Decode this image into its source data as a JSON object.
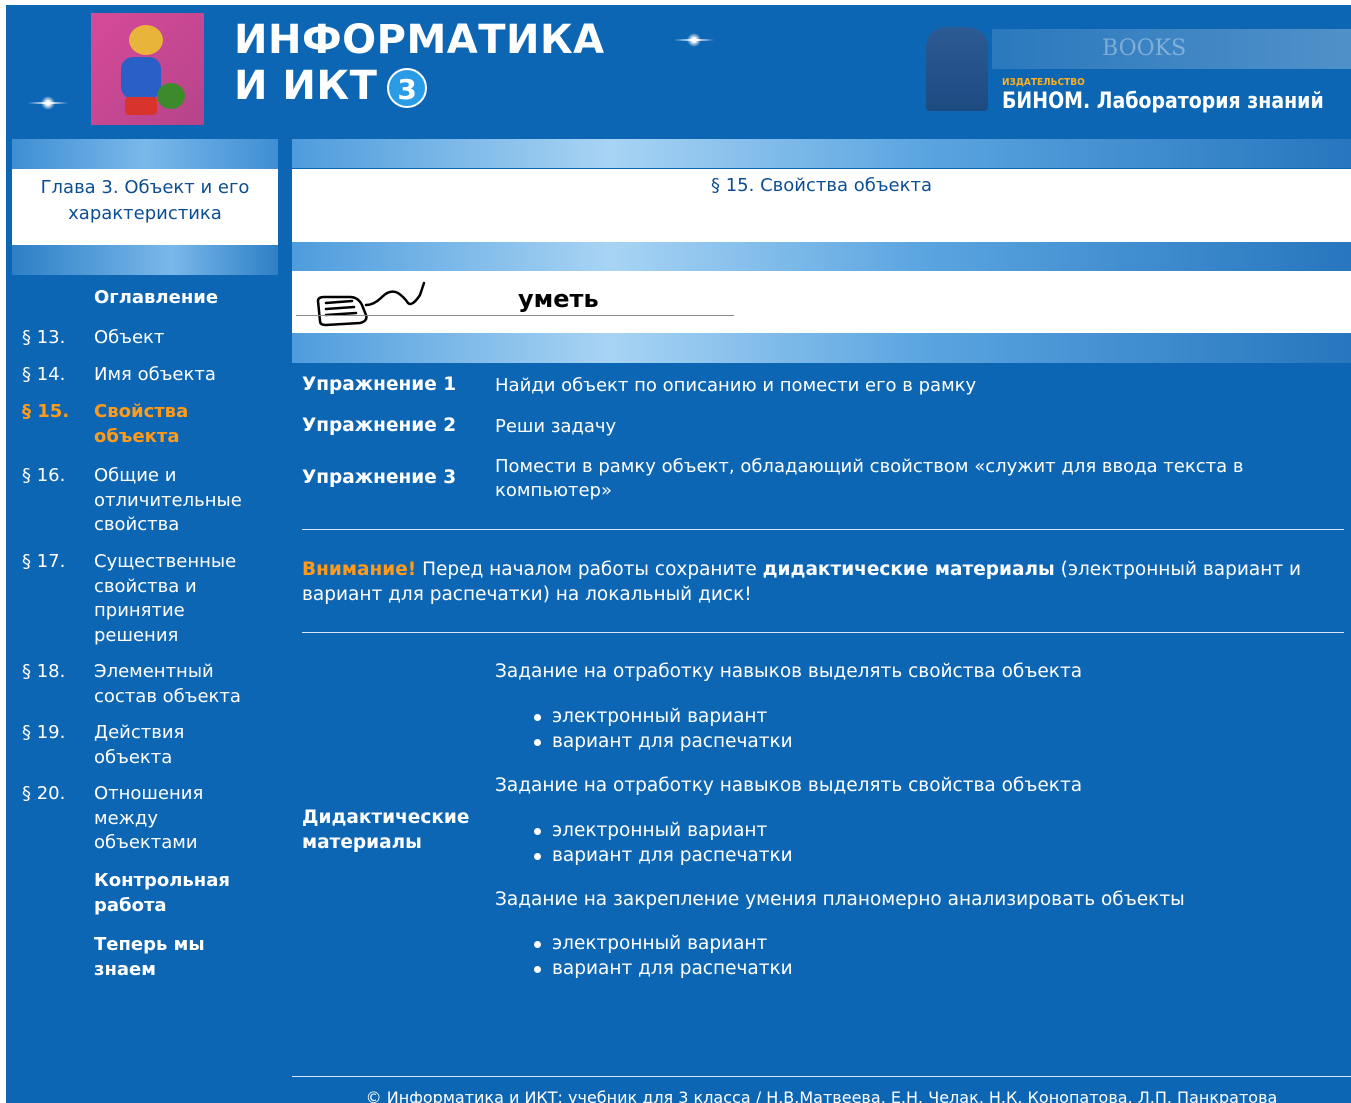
{
  "header": {
    "title_line1": "ИНФОРМАТИКА",
    "title_line2": "И ИКТ",
    "grade": "3",
    "publisher_small": "ИЗДАТЕЛЬСТВО",
    "publisher_name": "БИНОМ. Лаборатория знаний",
    "books_text": "BOOKS"
  },
  "sidebar": {
    "chapter": "Глава 3. Объект и его характеристика",
    "toc_heading": "Оглавление",
    "items": [
      {
        "num": "§ 13.",
        "label": "Объект",
        "active": false
      },
      {
        "num": "§ 14.",
        "label": "Имя объекта",
        "active": false
      },
      {
        "num": "§ 15.",
        "label": "Свойства объекта",
        "active": true
      },
      {
        "num": "§ 16.",
        "label": "Общие и отличительные свойства",
        "active": false
      },
      {
        "num": "§ 17.",
        "label": "Существенные свойства и принятие решения",
        "active": false
      },
      {
        "num": "§ 18.",
        "label": "Элементный состав объекта",
        "active": false
      },
      {
        "num": "§ 19.",
        "label": "Действия объекта",
        "active": false
      },
      {
        "num": "§ 20.",
        "label": "Отношения между объектами",
        "active": false
      }
    ],
    "control_work": "Контрольная работа",
    "now_we_know": "Теперь мы знаем"
  },
  "main": {
    "section_title": "§ 15. Свойства объекта",
    "skill_heading": "уметь",
    "exercises": [
      {
        "label": "Упражнение 1",
        "desc": "Найди объект по описанию и помести его в рамку"
      },
      {
        "label": "Упражнение 2",
        "desc": "Реши задачу"
      },
      {
        "label": "Упражнение 3",
        "desc": "Помести в рамку объект, обладающий свойством «служит для ввода текста в компьютер»"
      }
    ],
    "attention": {
      "warn": "Внимание!",
      "text1": " Перед началом работы сохраните ",
      "bold": "дидактические материалы",
      "text2": " (электронный вариант и вариант для распечатки) на локальный диск!"
    },
    "didactic_label": "Дидактические материалы",
    "tasks": [
      {
        "title": "Задание на отработку навыков выделять свойства объекта",
        "links": [
          "электронный вариант",
          "вариант для распечатки"
        ]
      },
      {
        "title": "Задание на отработку навыков выделять свойства объекта",
        "links": [
          "электронный вариант",
          "вариант для распечатки"
        ]
      },
      {
        "title": "Задание на закрепление умения планомерно анализировать объекты",
        "links": [
          "электронный вариант",
          "вариант для распечатки"
        ]
      }
    ]
  },
  "footer": {
    "copyright": "© Информатика и ИКТ: учебник для 3 класса / Н.В.Матвеева, Е.Н. Челак, Н.К. Конопатова, Л.П. Панкратова"
  },
  "colors": {
    "background": "#0d66b4",
    "accent_orange": "#ff9a1a",
    "heading_dark_blue": "#0d4e92"
  }
}
